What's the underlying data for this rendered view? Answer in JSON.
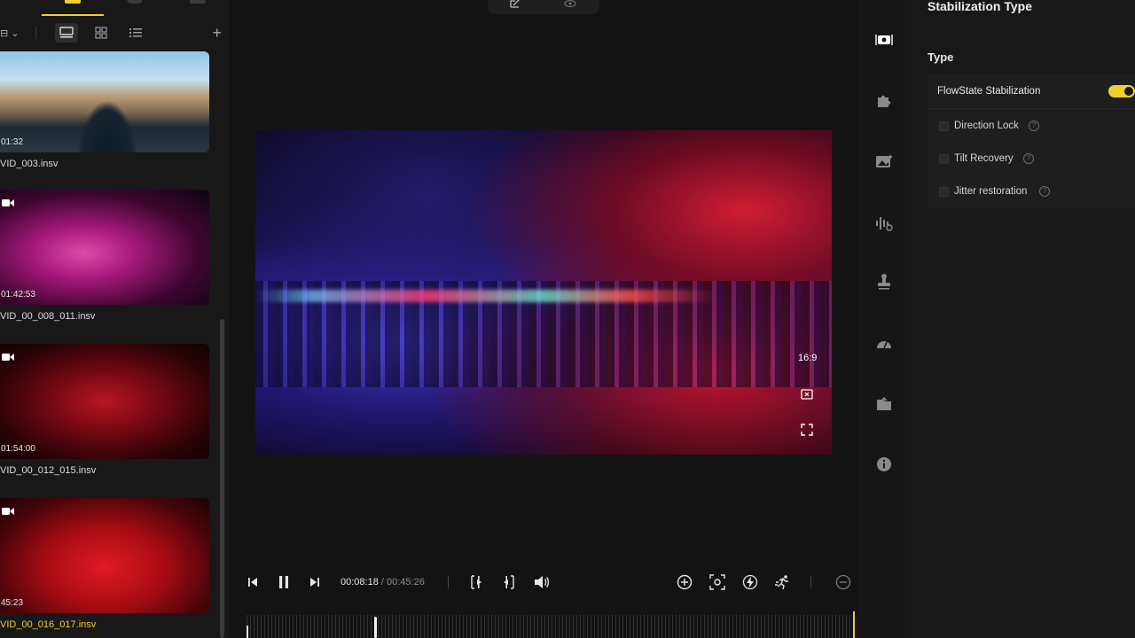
{
  "media_panel": {
    "filter_label": "⊟ ⌄",
    "add_label": "+",
    "items": [
      {
        "duration": "01:32",
        "filename": "VID_003.insv",
        "active": false,
        "has_camera_icon": false
      },
      {
        "duration": "01:42:53",
        "filename": "VID_00_008_011.insv",
        "active": false,
        "has_camera_icon": true
      },
      {
        "duration": "01:54:00",
        "filename": "VID_00_012_015.insv",
        "active": false,
        "has_camera_icon": true
      },
      {
        "duration": "45:23",
        "filename": "VID_00_016_017.insv",
        "active": true,
        "has_camera_icon": true
      }
    ]
  },
  "preview": {
    "aspect_ratio": "16:9",
    "current_time": "00:08:18",
    "total_time": "/ 00:45:26"
  },
  "settings": {
    "title": "Stabilization Type",
    "section_label": "Type",
    "main_option": "FlowState Stabilization",
    "main_enabled": true,
    "options": [
      {
        "label": "Direction Lock",
        "checked": false
      },
      {
        "label": "Tilt Recovery",
        "checked": false
      },
      {
        "label": "Jitter restoration",
        "checked": false
      }
    ],
    "help_glyph": "?"
  },
  "colors": {
    "accent": "#f2cf2c",
    "panel_bg": "#181818",
    "center_bg": "#131313"
  }
}
